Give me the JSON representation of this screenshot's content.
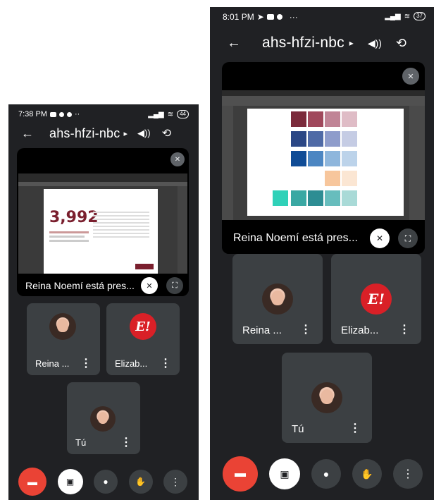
{
  "left": {
    "status_time": "7:38 PM",
    "status_extra": "··",
    "battery": "44",
    "meeting_code": "ahs-hfzi-nbc",
    "presenting_label": "Reina Noemí está pres...",
    "doc_number": "3,992",
    "participants": [
      {
        "name": "Reina ...",
        "type": "photo"
      },
      {
        "name": "Elizab...",
        "type": "logo"
      },
      {
        "name": "Tú",
        "type": "photo"
      }
    ]
  },
  "right": {
    "status_time": "8:01 PM",
    "status_extra": "···",
    "battery": "37",
    "meeting_code": "ahs-hfzi-nbc",
    "presenting_label": "Reina Noemí está pres...",
    "participants": [
      {
        "name": "Reina ...",
        "type": "photo"
      },
      {
        "name": "Elizab...",
        "type": "logo"
      },
      {
        "name": "Tú",
        "type": "photo"
      }
    ]
  },
  "logo_text": "E!",
  "icons": {
    "back": "←",
    "chevron": "▸",
    "speaker": "🔊",
    "switch_camera": "⟲",
    "more": "⋮",
    "hang_up": "☎",
    "mic": "🎤",
    "hand": "✋"
  },
  "colors": {
    "end_call": "#ea4335",
    "tile_bg": "#3c4043",
    "screen_bg": "#202124"
  }
}
